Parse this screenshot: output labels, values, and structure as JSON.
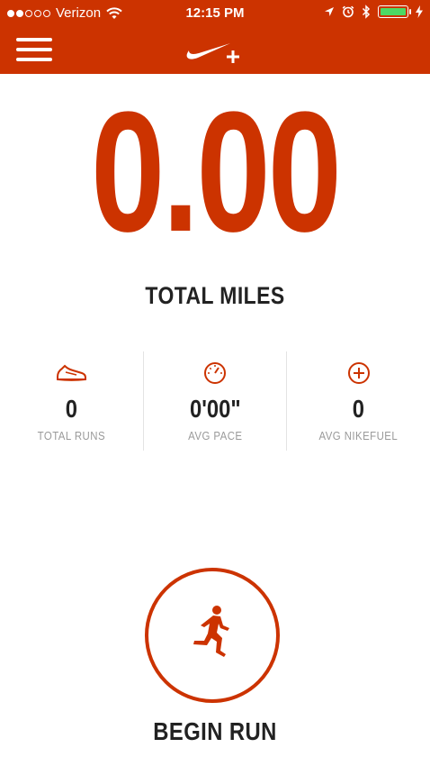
{
  "status_bar": {
    "carrier": "Verizon",
    "time": "12:15 PM",
    "signal_bars_filled": 2,
    "signal_bars_total": 5,
    "battery_color": "#4cd964"
  },
  "nav": {
    "menu_icon": "hamburger-icon",
    "logo": "nike-plus-logo"
  },
  "summary": {
    "total_miles_value": "0.00",
    "total_miles_label": "TOTAL MILES"
  },
  "stats": [
    {
      "icon": "shoe-icon",
      "value": "0",
      "label": "TOTAL RUNS"
    },
    {
      "icon": "speedometer-icon",
      "value": "0'00\"",
      "label": "AVG PACE"
    },
    {
      "icon": "nikefuel-plus-icon",
      "value": "0",
      "label": "AVG NIKEFUEL"
    }
  ],
  "begin_run": {
    "icon": "runner-icon",
    "label": "BEGIN RUN"
  },
  "colors": {
    "brand": "#cc3300",
    "text": "#222222",
    "muted": "#9a9a9a"
  }
}
